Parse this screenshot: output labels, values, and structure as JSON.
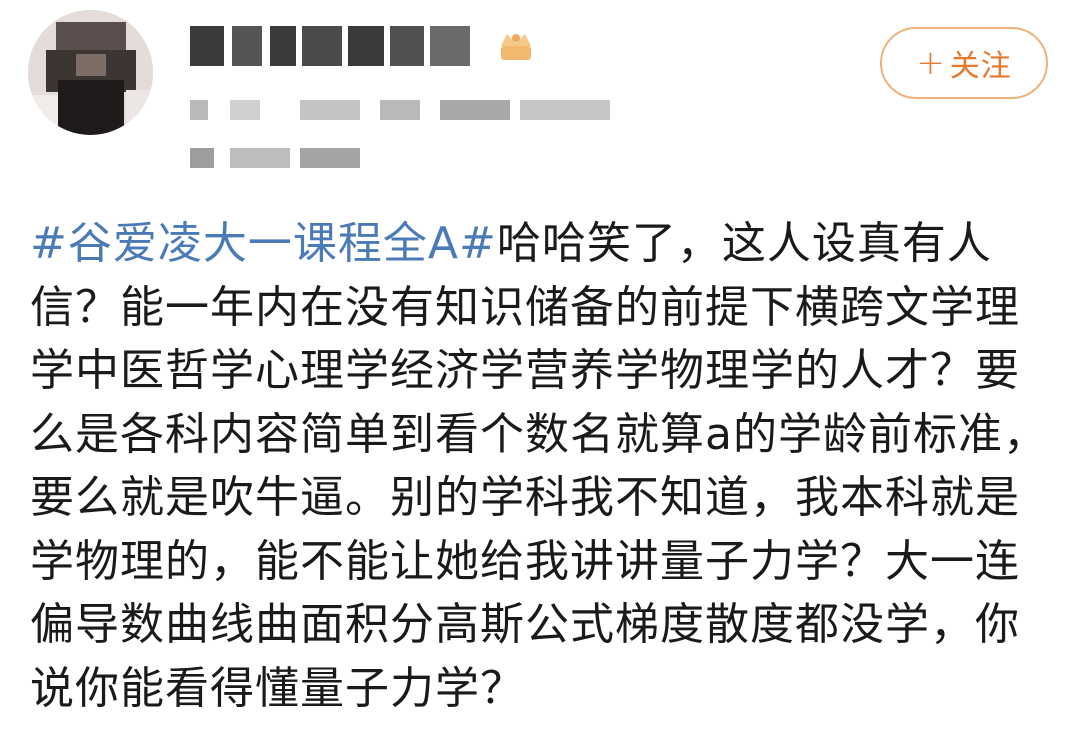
{
  "post": {
    "follow_button": {
      "label": "关注",
      "plus": "+"
    },
    "hashtag": "#谷爱凌大一课程全A#",
    "body_text": "哈哈笑了，这人设真有人信？能一年内在没有知识储备的前提下横跨文学理学中医哲学心理学经济学营养学物理学的人才？要么是各科内容简单到看个数名就算a的学龄前标准，要么就是吹牛逼。别的学科我不知道，我本科就是学物理的，能不能让她给我讲讲量子力学？大一连偏导数曲线曲面积分高斯公式梯度散度都没学，你说你能看得懂量子力学？"
  },
  "colors": {
    "hashtag": "#4a7bb7",
    "follow_accent": "#e8782a",
    "follow_border": "#f0b27a",
    "text": "#1a1a1a"
  },
  "icons": {
    "vip": "crown-icon"
  }
}
